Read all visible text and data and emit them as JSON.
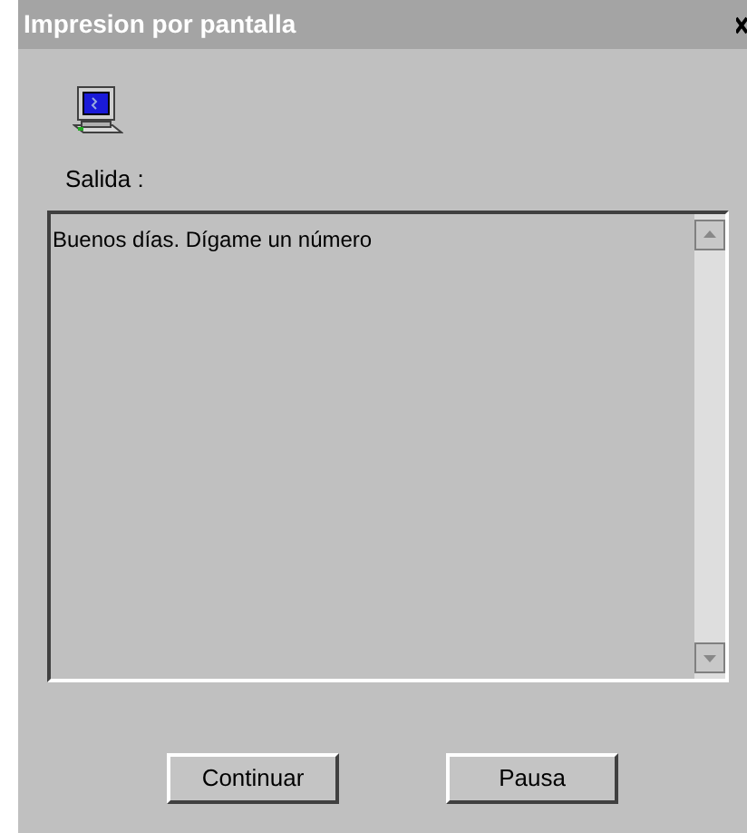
{
  "window": {
    "title": "Impresion por pantalla"
  },
  "output": {
    "label": "Salida :",
    "text": "Buenos días. Dígame un número"
  },
  "buttons": [
    "Continuar",
    "Pausa"
  ]
}
